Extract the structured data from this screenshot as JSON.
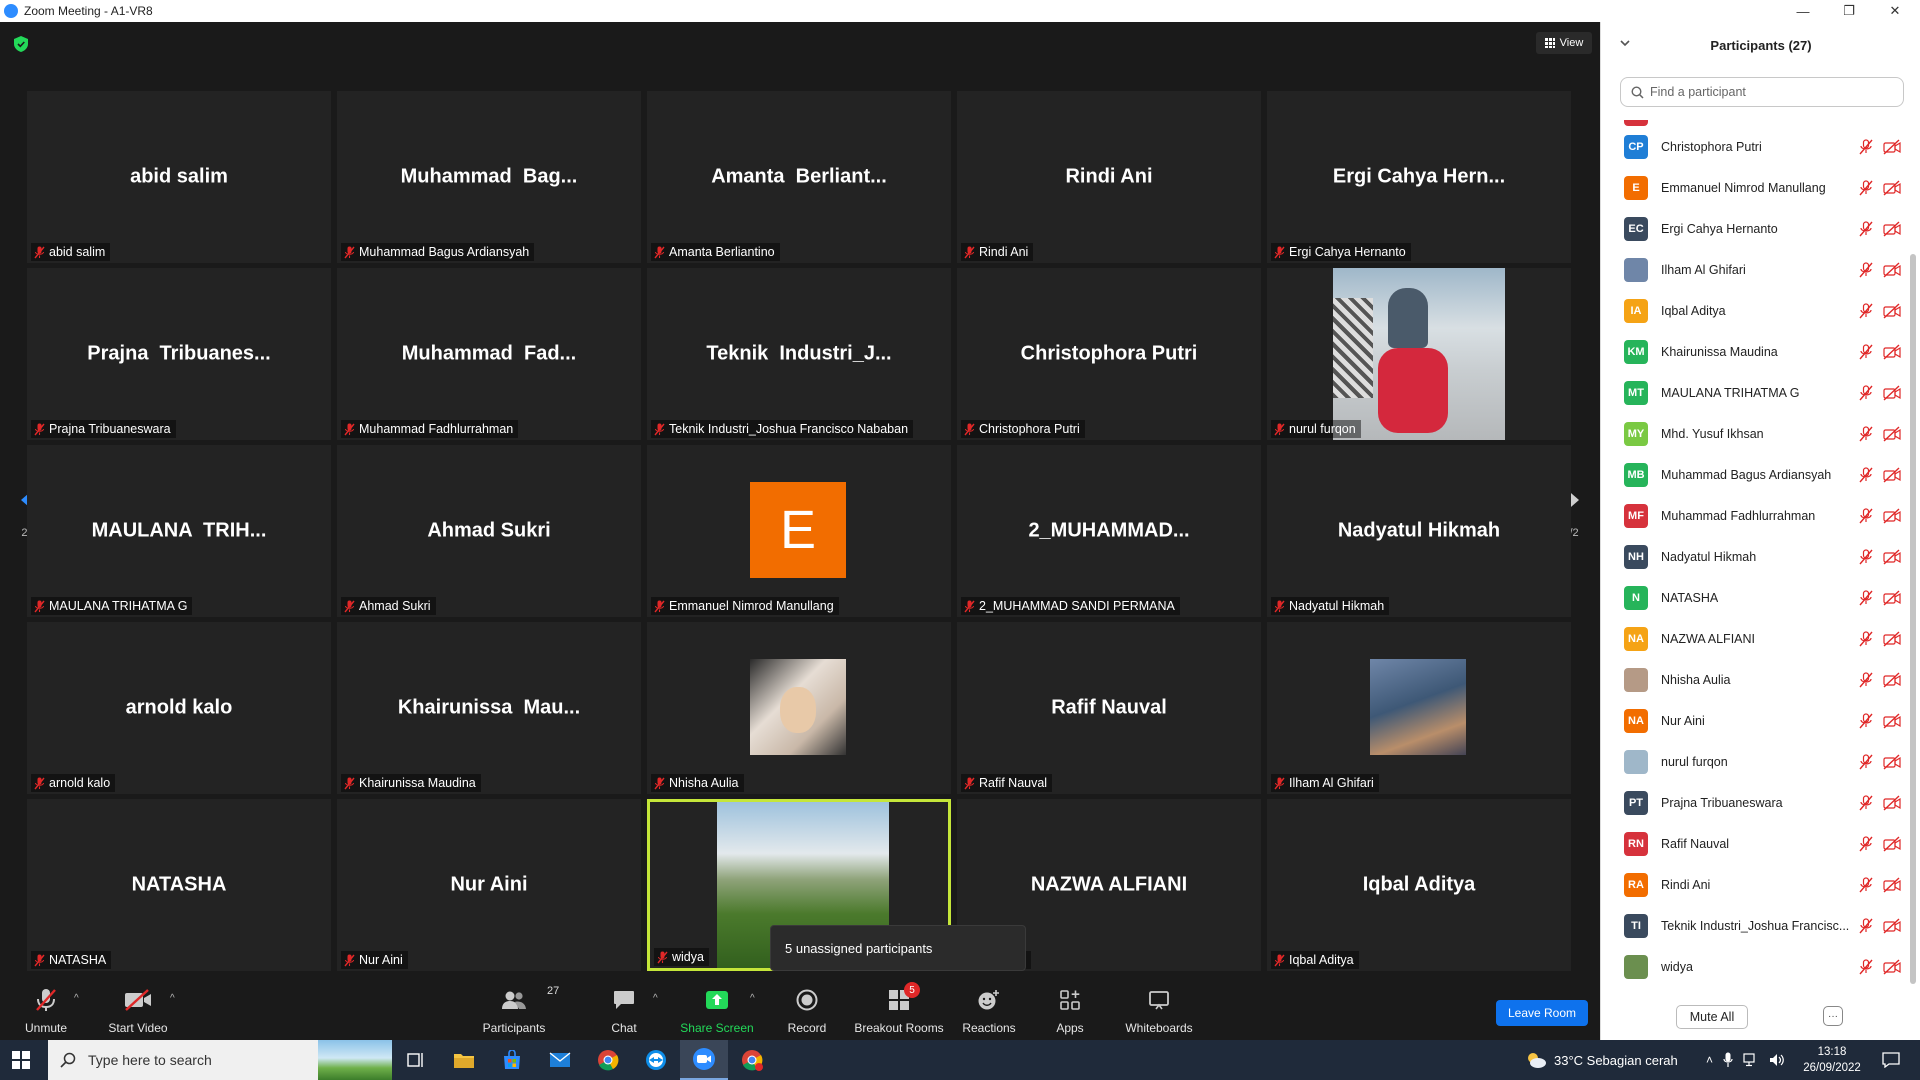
{
  "window": {
    "title": "Zoom Meeting - A1-VR8"
  },
  "top": {
    "view_label": "View"
  },
  "pager": {
    "page": "2/2"
  },
  "tiles": [
    {
      "display": "abid salim",
      "label": "abid salim"
    },
    {
      "display": "Muhammad  Bag...",
      "label": "Muhammad Bagus Ardiansyah"
    },
    {
      "display": "Amanta  Berliant...",
      "label": "Amanta Berliantino"
    },
    {
      "display": "Rindi Ani",
      "label": "Rindi Ani"
    },
    {
      "display": "Ergi Cahya Hern...",
      "label": "Ergi Cahya Hernanto"
    },
    {
      "display": "Prajna  Tribuanes...",
      "label": "Prajna Tribuaneswara"
    },
    {
      "display": "Muhammad  Fad...",
      "label": "Muhammad Fadhlurrahman"
    },
    {
      "display": "Teknik  Industri_J...",
      "label": "Teknik Industri_Joshua Francisco Nababan"
    },
    {
      "display": "Christophora Putri",
      "label": "Christophora Putri"
    },
    {
      "display": "",
      "label": "nurul furqon"
    },
    {
      "display": "MAULANA  TRIH...",
      "label": "MAULANA TRIHATMA G"
    },
    {
      "display": "Ahmad Sukri",
      "label": "Ahmad Sukri"
    },
    {
      "display": "",
      "label": "Emmanuel Nimrod Manullang",
      "avatar_letter": "E"
    },
    {
      "display": "2_MUHAMMAD...",
      "label": "2_MUHAMMAD SANDI PERMANA"
    },
    {
      "display": "Nadyatul Hikmah",
      "label": "Nadyatul Hikmah"
    },
    {
      "display": "arnold kalo",
      "label": "arnold kalo"
    },
    {
      "display": "Khairunissa  Mau...",
      "label": "Khairunissa Maudina"
    },
    {
      "display": "",
      "label": "Nhisha Aulia"
    },
    {
      "display": "Rafif Nauval",
      "label": "Rafif Nauval"
    },
    {
      "display": "",
      "label": "Ilham Al Ghifari"
    },
    {
      "display": "NATASHA",
      "label": "NATASHA"
    },
    {
      "display": "Nur Aini",
      "label": "Nur Aini"
    },
    {
      "display": "",
      "label": "widya"
    },
    {
      "display": "NAZWA ALFIANI",
      "label": "ALFIANI"
    },
    {
      "display": "Iqbal Aditya",
      "label": "Iqbal Aditya"
    }
  ],
  "tooltip": "5 unassigned participants",
  "toolbar": {
    "unmute": "Unmute",
    "start_video": "Start Video",
    "participants": "Participants",
    "participants_count": "27",
    "chat": "Chat",
    "share_screen": "Share Screen",
    "record": "Record",
    "breakout_rooms": "Breakout Rooms",
    "breakout_badge": "5",
    "reactions": "Reactions",
    "apps": "Apps",
    "whiteboards": "Whiteboards",
    "leave": "Leave Room"
  },
  "panel": {
    "title": "Participants (27)",
    "search_placeholder": "Find a participant",
    "mute_all": "Mute All",
    "more": "···",
    "participants": [
      {
        "initials": "CP",
        "name": "Christophora Putri",
        "color": "#1f7ed6"
      },
      {
        "initials": "E",
        "name": "Emmanuel Nimrod Manullang",
        "color": "#f26d00"
      },
      {
        "initials": "EC",
        "name": "Ergi Cahya Hernanto",
        "color": "#3a4a5e"
      },
      {
        "initials": "",
        "name": "Ilham Al Ghifari",
        "color": "#6f86a8"
      },
      {
        "initials": "IA",
        "name": "Iqbal Aditya",
        "color": "#f5a315"
      },
      {
        "initials": "KM",
        "name": "Khairunissa Maudina",
        "color": "#26b45a"
      },
      {
        "initials": "MT",
        "name": "MAULANA TRIHATMA G",
        "color": "#26b45a"
      },
      {
        "initials": "MY",
        "name": "Mhd. Yusuf Ikhsan",
        "color": "#7ac943"
      },
      {
        "initials": "MB",
        "name": "Muhammad Bagus Ardiansyah",
        "color": "#26b45a"
      },
      {
        "initials": "MF",
        "name": "Muhammad Fadhlurrahman",
        "color": "#d6323c"
      },
      {
        "initials": "NH",
        "name": "Nadyatul Hikmah",
        "color": "#3a4a5e"
      },
      {
        "initials": "N",
        "name": "NATASHA",
        "color": "#26b45a"
      },
      {
        "initials": "NA",
        "name": "NAZWA ALFIANI",
        "color": "#f5a315"
      },
      {
        "initials": "",
        "name": "Nhisha Aulia",
        "color": "#b59a86"
      },
      {
        "initials": "NA",
        "name": "Nur Aini",
        "color": "#f26d00"
      },
      {
        "initials": "",
        "name": "nurul furqon",
        "color": "#9fb7c9"
      },
      {
        "initials": "PT",
        "name": "Prajna Tribuaneswara",
        "color": "#3a4a5e"
      },
      {
        "initials": "RN",
        "name": "Rafif Nauval",
        "color": "#d6323c"
      },
      {
        "initials": "RA",
        "name": "Rindi Ani",
        "color": "#f26d00"
      },
      {
        "initials": "TI",
        "name": "Teknik Industri_Joshua Francisc...",
        "color": "#3a4a5e"
      },
      {
        "initials": "",
        "name": "widya",
        "color": "#6b8f4f"
      }
    ]
  },
  "taskbar": {
    "search_placeholder": "Type here to search",
    "weather": "33°C  Sebagian cerah",
    "time": "13:18",
    "date": "26/09/2022"
  }
}
